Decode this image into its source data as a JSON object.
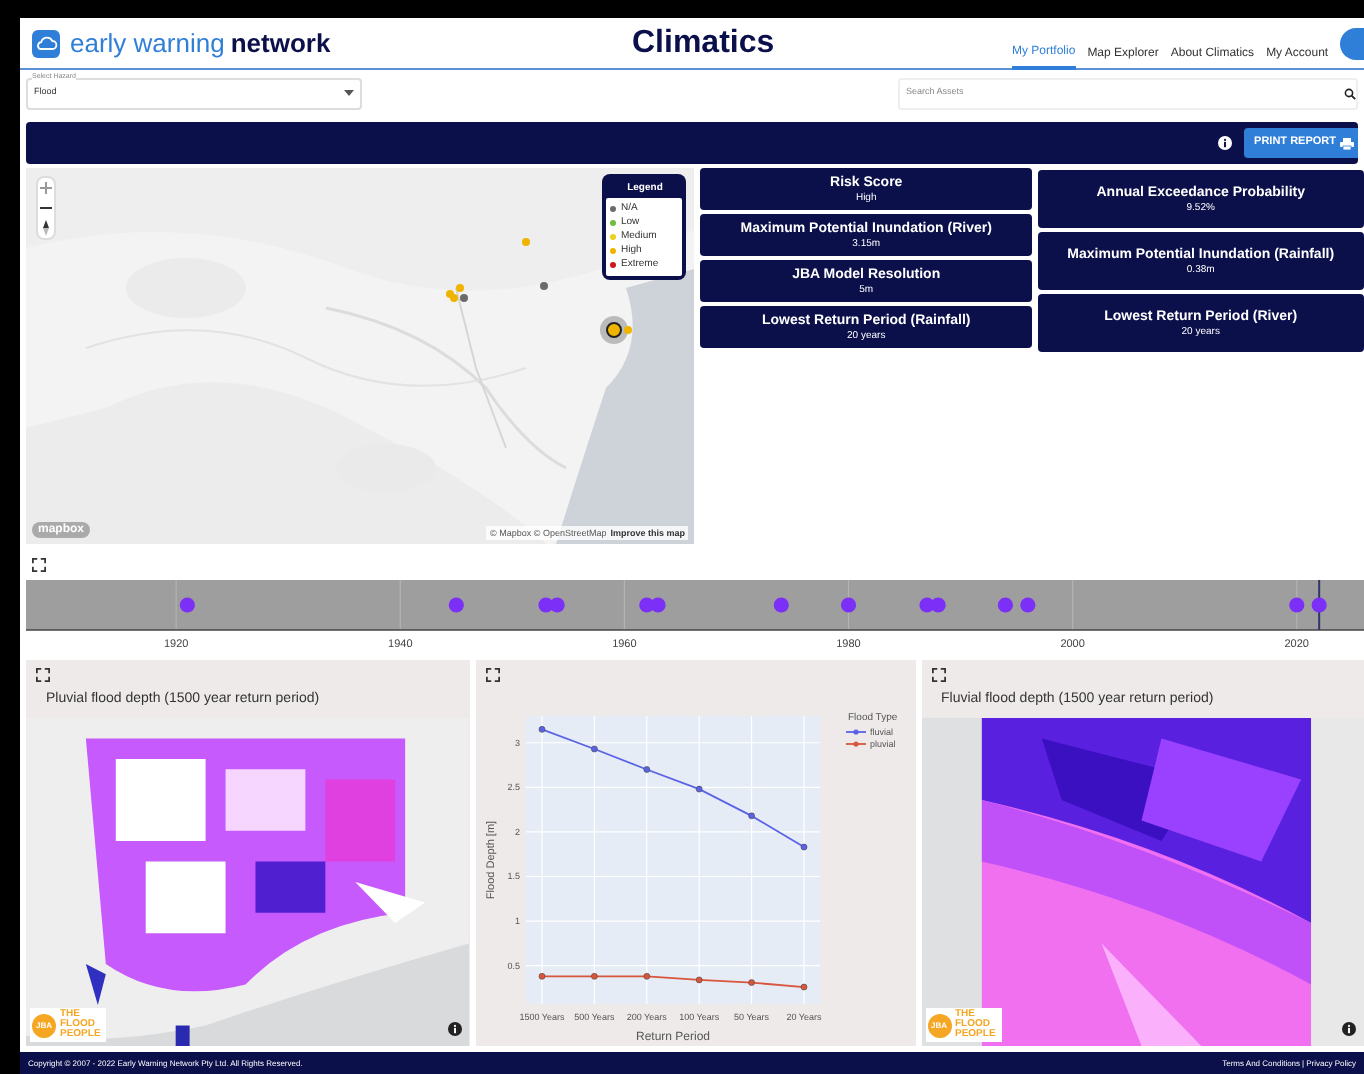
{
  "header": {
    "brand_light": "early warning",
    "brand_bold": "network",
    "title": "Climatics",
    "nav": [
      {
        "label": "My Portfolio",
        "selected": true
      },
      {
        "label": "Map Explorer",
        "selected": false
      },
      {
        "label": "About Climatics",
        "selected": false
      },
      {
        "label": "My Account",
        "selected": false
      }
    ]
  },
  "hazard_select": {
    "label": "Select Hazard",
    "value": "Flood"
  },
  "search": {
    "placeholder": "Search Assets"
  },
  "toolbar": {
    "print_button": "PRINT REPORT"
  },
  "map": {
    "legend": {
      "title": "Legend",
      "items": [
        {
          "label": "N/A",
          "color": "#6b6b6b"
        },
        {
          "label": "Low",
          "color": "#6cbf3a"
        },
        {
          "label": "Medium",
          "color": "#e6d21a"
        },
        {
          "label": "High",
          "color": "#f0b400"
        },
        {
          "label": "Extreme",
          "color": "#d0161b"
        }
      ]
    },
    "markers": [
      {
        "color": "#f0b400",
        "selected": false
      },
      {
        "color": "#6b6b6b",
        "selected": false
      },
      {
        "color": "#f0b400",
        "selected": false
      },
      {
        "color": "#f0b400",
        "selected": false
      },
      {
        "color": "#f0b400",
        "selected": false
      },
      {
        "color": "#6b6b6b",
        "selected": false
      },
      {
        "color": "#f0b400",
        "selected": true
      },
      {
        "color": "#f0b400",
        "selected": false
      }
    ],
    "logo": "mapbox",
    "attribution": "© Mapbox © OpenStreetMap",
    "improve_link": "Improve this map"
  },
  "cards_left": [
    {
      "title": "Risk Score",
      "value": "High"
    },
    {
      "title": "Maximum Potential Inundation (River)",
      "value": "3.15m"
    },
    {
      "title": "JBA Model Resolution",
      "value": "5m"
    },
    {
      "title": "Lowest Return Period (Rainfall)",
      "value": "20 years"
    }
  ],
  "cards_right": [
    {
      "title": "Annual Exceedance Probability",
      "value": "9.52%"
    },
    {
      "title": "Maximum Potential Inundation (Rainfall)",
      "value": "0.38m"
    },
    {
      "title": "Lowest Return Period (River)",
      "value": "20 years"
    }
  ],
  "timeline": {
    "axis_labels": [
      "1920",
      "1940",
      "1960",
      "1980",
      "2000",
      "2020"
    ]
  },
  "panels": [
    {
      "title": "Pluvial flood depth (1500 year return period)",
      "logo_brand": "JBA",
      "logo_text": "THE FLOOD PEOPLE"
    },
    {
      "kind": "chart",
      "chart_data": {
        "type": "line",
        "xlabel": "Return Period",
        "ylabel": "Flood Depth [m]",
        "categories": [
          "1500 Years",
          "500 Years",
          "200 Years",
          "100 Years",
          "50 Years",
          "20 Years"
        ],
        "series": [
          {
            "name": "fluvial",
            "color": "#5a63e6",
            "marker": "circle",
            "values": [
              3.15,
              2.93,
              2.7,
              2.48,
              2.18,
              1.83
            ]
          },
          {
            "name": "pluvial",
            "color": "#d9553b",
            "marker": "circle",
            "values": [
              0.38,
              0.38,
              0.38,
              0.34,
              0.31,
              0.26
            ]
          }
        ],
        "ylim": [
          0.07,
          3.3
        ],
        "yticks": [
          0.5,
          1,
          1.5,
          2,
          2.5,
          3
        ],
        "grid": true,
        "legend": {
          "title": "Flood Type"
        }
      }
    },
    {
      "title": "Fluvial flood depth (1500 year return period)",
      "logo_brand": "JBA",
      "logo_text": "THE FLOOD PEOPLE"
    }
  ],
  "footer": {
    "copyright": "Copyright © 2007 - 2022 Early Warning Network Pty Ltd. All Rights Reserved.",
    "links": [
      "Terms And Conditions",
      "Privacy Policy"
    ],
    "separator": "|"
  }
}
